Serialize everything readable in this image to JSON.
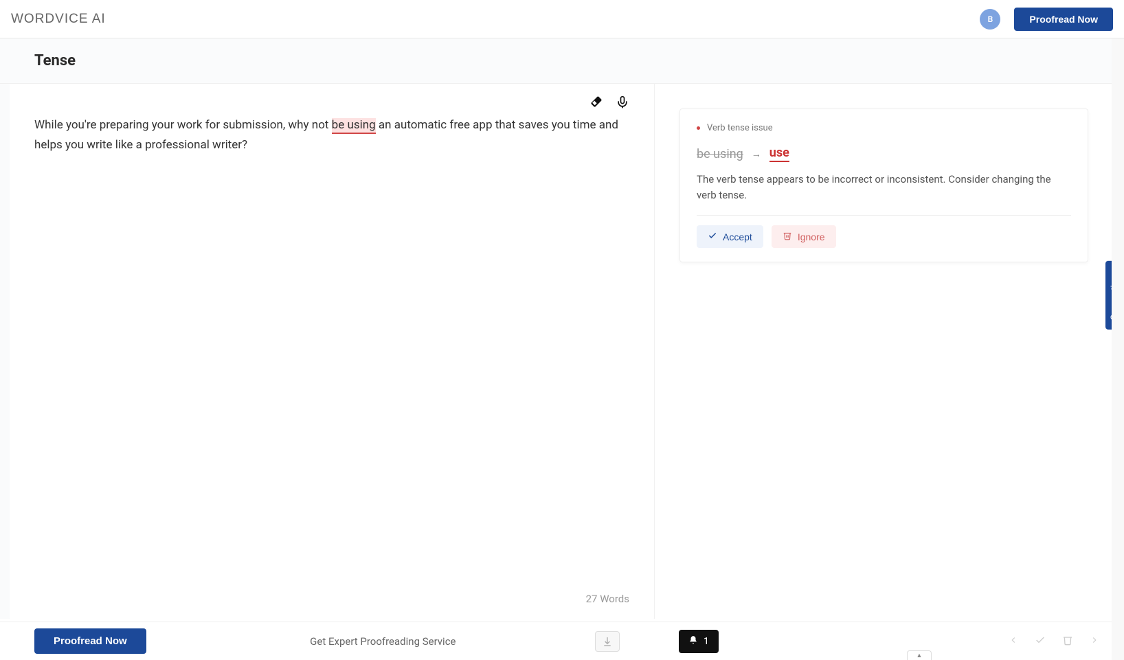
{
  "header": {
    "logo": "WORDVICE AI",
    "avatar_initial": "B",
    "proofread_button": "Proofread Now"
  },
  "page": {
    "title": "Tense"
  },
  "editor": {
    "text_before": "While you're preparing your work for submission, why not ",
    "text_highlight": "be using",
    "text_after": " an automatic free app that saves you time and helps you write like a professional writer?",
    "word_count": "27 Words"
  },
  "suggestion": {
    "issue_type": "Verb tense issue",
    "original": "be using",
    "replacement": "use",
    "explanation": "The verb tense appears to be incorrect or inconsistent. Consider changing the verb tense.",
    "accept_label": "Accept",
    "ignore_label": "Ignore"
  },
  "side_tab": {
    "label": "Suggestions"
  },
  "bottom": {
    "proofread_button": "Proofread Now",
    "expert_link": "Get Expert Proofreading Service",
    "notification_count": "1"
  }
}
